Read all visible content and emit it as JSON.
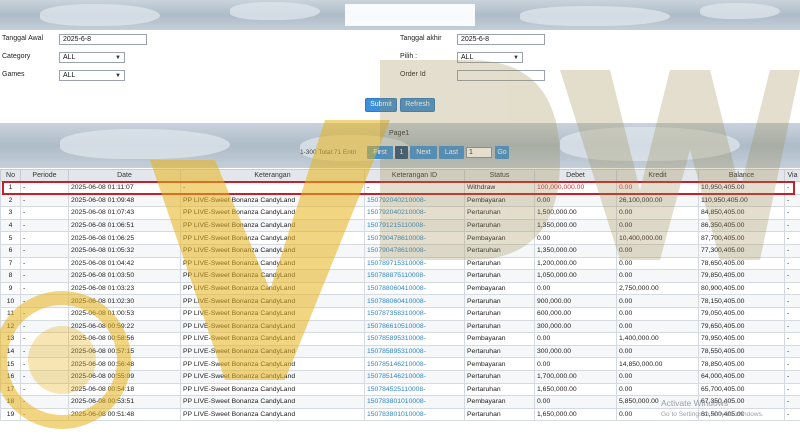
{
  "filters": {
    "tanggal_awal_label": "Tanggal Awal",
    "tanggal_awal_value": "2025-6-8",
    "tanggal_akhir_label": "Tanggal akhir",
    "tanggal_akhir_value": "2025-6-8",
    "category_label": "Category",
    "category_value": "ALL",
    "pilih_label": "Pilih :",
    "pilih_value": "ALL",
    "games_label": "Games",
    "games_value": "ALL",
    "order_id_label": "Order Id",
    "order_id_value": ""
  },
  "buttons": {
    "submit": "Submit",
    "refresh": "Refresh"
  },
  "pager": {
    "page_label": "Page1",
    "total_text": "1-300 Total:71 Entri",
    "first": "First",
    "current": "1",
    "next": "Next",
    "last": "Last",
    "page_input": "1",
    "go": "Go"
  },
  "table": {
    "headers": [
      "No",
      "Periode",
      "Date",
      "Keterangan",
      "Keterangan ID",
      "Status",
      "Debet",
      "Kredit",
      "Balance",
      "Via"
    ],
    "rows": [
      [
        "1",
        "-",
        "2025-06-08 01:11:07",
        "-",
        "-",
        "Withdraw",
        "100,000,000.00",
        "0.00",
        "10,950,405.00",
        "-"
      ],
      [
        "2",
        "-",
        "2025-06-08 01:09:48",
        "PP LIVE-Sweet Bonanza CandyLand",
        "150792040210008-",
        "Pembayaran",
        "0.00",
        "26,100,000.00",
        "110,950,405.00",
        "-"
      ],
      [
        "3",
        "-",
        "2025-06-08 01:07:43",
        "PP LIVE-Sweet Bonanza CandyLand",
        "150792040210008-",
        "Pertaruhan",
        "1,500,000.00",
        "0.00",
        "84,850,405.00",
        "-"
      ],
      [
        "4",
        "-",
        "2025-06-08 01:06:51",
        "PP LIVE-Sweet Bonanza CandyLand",
        "150791215110008-",
        "Pertaruhan",
        "1,350,000.00",
        "0.00",
        "86,350,405.00",
        "-"
      ],
      [
        "5",
        "-",
        "2025-06-08 01:06:25",
        "PP LIVE-Sweet Bonanza CandyLand",
        "150790478610008-",
        "Pembayaran",
        "0.00",
        "10,400,000.00",
        "87,700,405.00",
        "-"
      ],
      [
        "6",
        "-",
        "2025-06-08 01:05:32",
        "PP LIVE-Sweet Bonanza CandyLand",
        "150790478610008-",
        "Pertaruhan",
        "1,350,000.00",
        "0.00",
        "77,300,405.00",
        "-"
      ],
      [
        "7",
        "-",
        "2025-06-08 01:04:42",
        "PP LIVE-Sweet Bonanza CandyLand",
        "150789715310008-",
        "Pertaruhan",
        "1,200,000.00",
        "0.00",
        "78,650,405.00",
        "-"
      ],
      [
        "8",
        "-",
        "2025-06-08 01:03:50",
        "PP LIVE-Sweet Bonanza CandyLand",
        "150788875110008-",
        "Pertaruhan",
        "1,050,000.00",
        "0.00",
        "79,850,405.00",
        "-"
      ],
      [
        "9",
        "-",
        "2025-06-08 01:03:23",
        "PP LIVE-Sweet Bonanza CandyLand",
        "150788060410008-",
        "Pembayaran",
        "0.00",
        "2,750,000.00",
        "80,900,405.00",
        "-"
      ],
      [
        "10",
        "-",
        "2025-06-08 01:02:30",
        "PP LIVE-Sweet Bonanza CandyLand",
        "150788060410008-",
        "Pertaruhan",
        "900,000.00",
        "0.00",
        "78,150,405.00",
        "-"
      ],
      [
        "11",
        "-",
        "2025-06-08 01:00:53",
        "PP LIVE-Sweet Bonanza CandyLand",
        "150787358310008-",
        "Pertaruhan",
        "600,000.00",
        "0.00",
        "79,050,405.00",
        "-"
      ],
      [
        "12",
        "-",
        "2025-06-08 00:59:22",
        "PP LIVE-Sweet Bonanza CandyLand",
        "150786610510008-",
        "Pertaruhan",
        "300,000.00",
        "0.00",
        "79,650,405.00",
        "-"
      ],
      [
        "13",
        "-",
        "2025-06-08 00:58:56",
        "PP LIVE-Sweet Bonanza CandyLand",
        "150785895310008-",
        "Pembayaran",
        "0.00",
        "1,400,000.00",
        "79,950,405.00",
        "-"
      ],
      [
        "14",
        "-",
        "2025-06-08 00:57:15",
        "PP LIVE-Sweet Bonanza CandyLand",
        "150785895310008-",
        "Pertaruhan",
        "300,000.00",
        "0.00",
        "78,550,405.00",
        "-"
      ],
      [
        "15",
        "-",
        "2025-06-08 00:56:48",
        "PP LIVE-Sweet Bonanza CandyLand",
        "150785146210008-",
        "Pembayaran",
        "0.00",
        "14,850,000.00",
        "78,850,405.00",
        "-"
      ],
      [
        "16",
        "-",
        "2025-06-08 00:55:09",
        "PP LIVE-Sweet Bonanza CandyLand",
        "150785146210008-",
        "Pertaruhan",
        "1,700,000.00",
        "0.00",
        "64,000,405.00",
        "-"
      ],
      [
        "17",
        "-",
        "2025-06-08 00:54:18",
        "PP LIVE-Sweet Bonanza CandyLand",
        "150784525110008-",
        "Pertaruhan",
        "1,650,000.00",
        "0.00",
        "65,700,405.00",
        "-"
      ],
      [
        "18",
        "-",
        "2025-06-08 00:53:51",
        "PP LIVE-Sweet Bonanza CandyLand",
        "150783801010008-",
        "Pembayaran",
        "0.00",
        "5,850,000.00",
        "67,350,405.00",
        "-"
      ],
      [
        "19",
        "-",
        "2025-06-08 00:51:48",
        "PP LIVE-Sweet Bonanza CandyLand",
        "150783801010008-",
        "Pertaruhan",
        "1,650,000.00",
        "0.00",
        "61,500,405.00",
        "-"
      ]
    ]
  },
  "watermark": {
    "logo_text": "DVWK",
    "activate_title": "Activate Windows",
    "activate_sub": "Go to Settings to activate Windows."
  },
  "colors": {
    "accent": "#3d8fd9",
    "highlight": "#c8202a",
    "link": "#2f86c8",
    "gold": "#e7b21a"
  }
}
